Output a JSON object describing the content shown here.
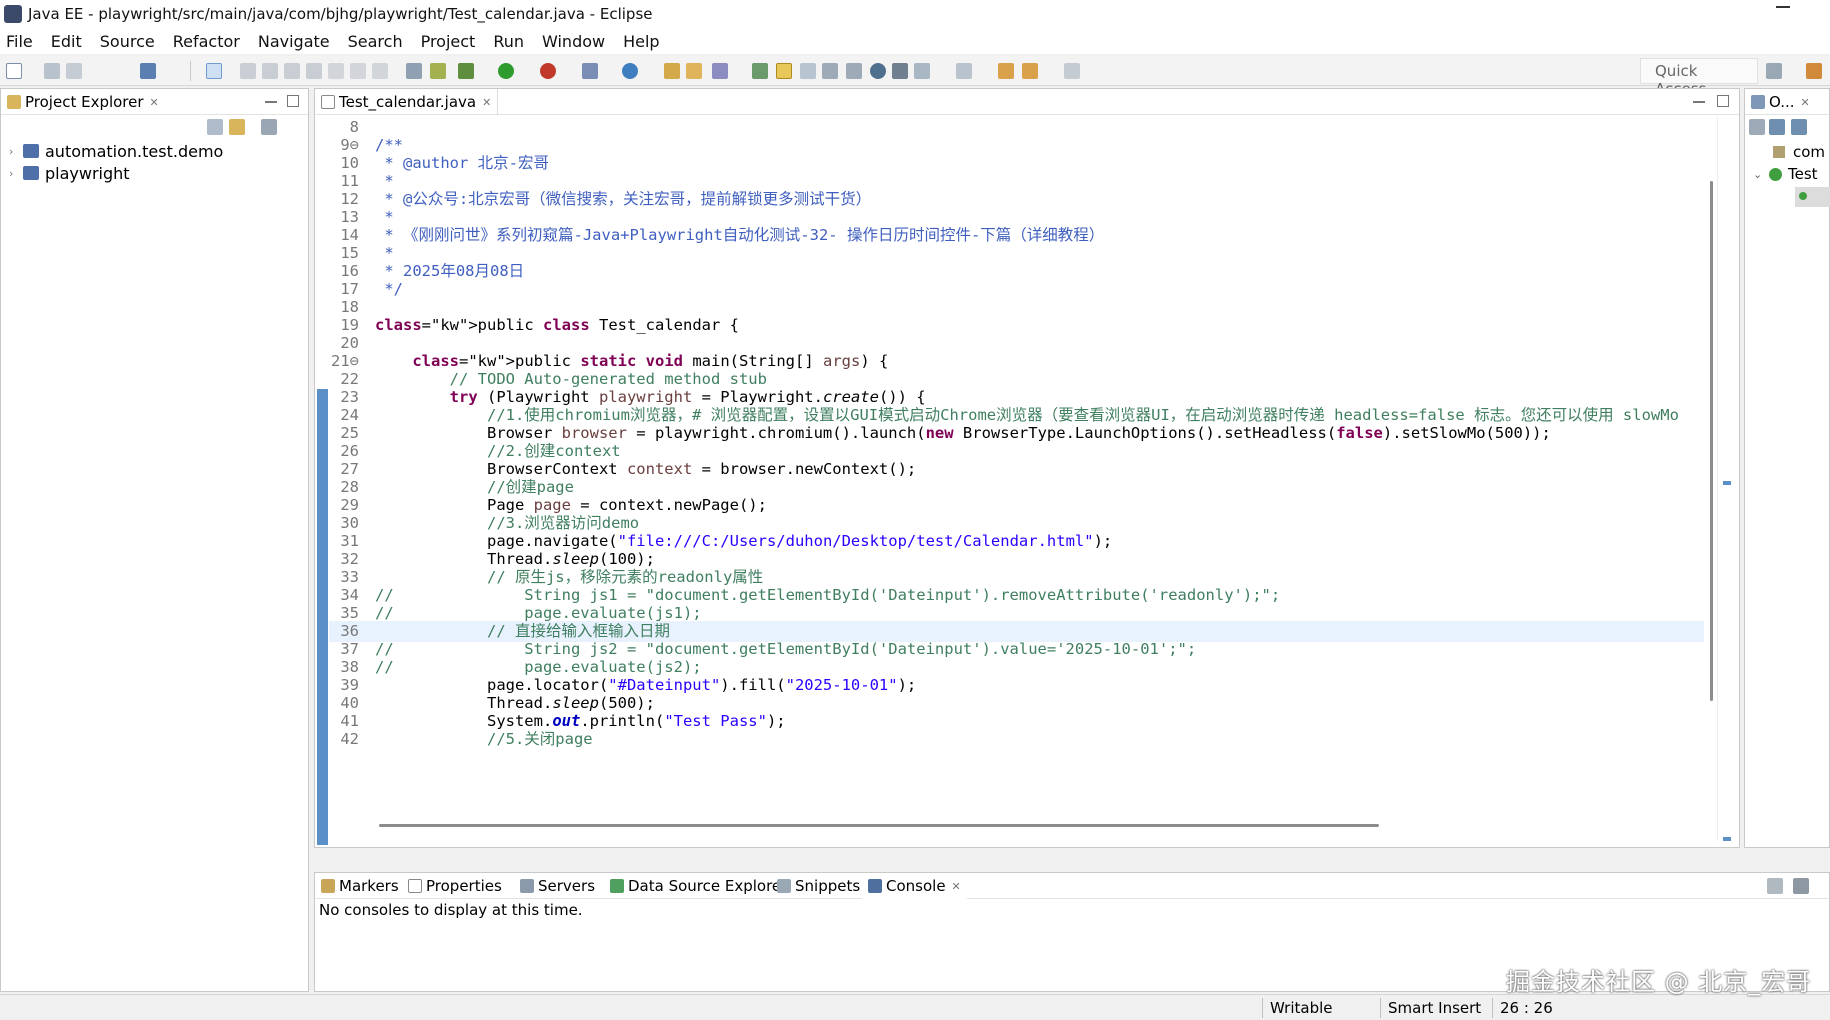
{
  "window": {
    "title": "Java EE - playwright/src/main/java/com/bjhg/playwright/Test_calendar.java - Eclipse"
  },
  "menu": [
    "File",
    "Edit",
    "Source",
    "Refactor",
    "Navigate",
    "Search",
    "Project",
    "Run",
    "Window",
    "Help"
  ],
  "quick_access": "Quick Access",
  "project_explorer": {
    "tab": "Project Explorer",
    "items": [
      "automation.test.demo",
      "playwright"
    ]
  },
  "editor": {
    "tab": "Test_calendar.java",
    "lines": [
      {
        "n": "8",
        "t": ""
      },
      {
        "n": "9⊖",
        "t": "/**"
      },
      {
        "n": "10",
        "t": " * @author 北京-宏哥"
      },
      {
        "n": "11",
        "t": " *"
      },
      {
        "n": "12",
        "t": " * @公众号:北京宏哥（微信搜索，关注宏哥，提前解锁更多测试干货）"
      },
      {
        "n": "13",
        "t": " *"
      },
      {
        "n": "14",
        "t": " * 《刚刚问世》系列初窥篇-Java+Playwright自动化测试-32- 操作日历时间控件-下篇（详细教程）"
      },
      {
        "n": "15",
        "t": " *"
      },
      {
        "n": "16",
        "t": " * 2025年08月08日"
      },
      {
        "n": "17",
        "t": " */"
      },
      {
        "n": "18",
        "t": ""
      },
      {
        "n": "19",
        "t": "public class Test_calendar {"
      },
      {
        "n": "20",
        "t": ""
      },
      {
        "n": "21⊖",
        "t": "    public static void main(String[] args) {"
      },
      {
        "n": "22",
        "t": "        // TODO Auto-generated method stub"
      },
      {
        "n": "23",
        "t": "        try (Playwright playwright = Playwright.create()) {"
      },
      {
        "n": "24",
        "t": "            //1.使用chromium浏览器，# 浏览器配置，设置以GUI模式启动Chrome浏览器（要查看浏览器UI，在启动浏览器时传递 headless=false 标志。您还可以使用 slowMo"
      },
      {
        "n": "25",
        "t": "            Browser browser = playwright.chromium().launch(new BrowserType.LaunchOptions().setHeadless(false).setSlowMo(500));"
      },
      {
        "n": "26",
        "t": "            //2.创建context"
      },
      {
        "n": "27",
        "t": "            BrowserContext context = browser.newContext();"
      },
      {
        "n": "28",
        "t": "            //创建page"
      },
      {
        "n": "29",
        "t": "            Page page = context.newPage();"
      },
      {
        "n": "30",
        "t": "            //3.浏览器访问demo"
      },
      {
        "n": "31",
        "t": "            page.navigate(\"file:///C:/Users/duhon/Desktop/test/Calendar.html\");"
      },
      {
        "n": "32",
        "t": "            Thread.sleep(100);"
      },
      {
        "n": "33",
        "t": "            // 原生js，移除元素的readonly属性"
      },
      {
        "n": "34",
        "t": "//              String js1 = \"document.getElementById('Dateinput').removeAttribute('readonly');\";"
      },
      {
        "n": "35",
        "t": "//              page.evaluate(js1);"
      },
      {
        "n": "36",
        "t": "            // 直接给输入框输入日期"
      },
      {
        "n": "37",
        "t": "//              String js2 = \"document.getElementById('Dateinput').value='2025-10-01';\";"
      },
      {
        "n": "38",
        "t": "//              page.evaluate(js2);"
      },
      {
        "n": "39",
        "t": "            page.locator(\"#Dateinput\").fill(\"2025-10-01\");"
      },
      {
        "n": "40",
        "t": "            Thread.sleep(500);"
      },
      {
        "n": "41",
        "t": "            System.out.println(\"Test Pass\");"
      },
      {
        "n": "42",
        "t": "            //5.关闭page"
      }
    ]
  },
  "outline": {
    "tab": "O...",
    "items": [
      "com",
      "Test"
    ]
  },
  "bottom_tabs": [
    "Markers",
    "Properties",
    "Servers",
    "Data Source Explorer",
    "Snippets",
    "Console"
  ],
  "console": {
    "message": "No consoles to display at this time."
  },
  "status": {
    "writable": "Writable",
    "insert_mode": "Smart Insert",
    "position": "26 : 26"
  },
  "watermark": "掘金技术社区 @ 北京_宏哥",
  "colors": {
    "keyword": "#7f0055",
    "comment": "#3f7f5f",
    "javadoc": "#3f5fbf",
    "string": "#2a00ff",
    "gutter_marker": "#5b8fc7"
  }
}
